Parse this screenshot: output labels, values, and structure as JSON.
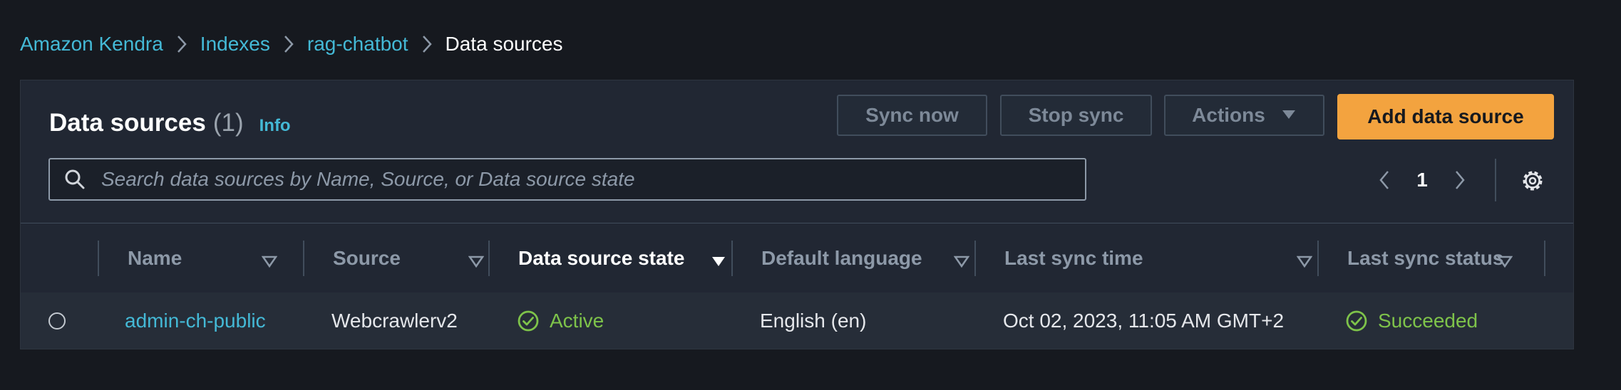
{
  "breadcrumb": {
    "items": [
      "Amazon Kendra",
      "Indexes",
      "rag-chatbot"
    ],
    "current": "Data sources"
  },
  "panel": {
    "title": "Data sources",
    "count": "(1)",
    "info": "Info"
  },
  "toolbar": {
    "sync_now": "Sync now",
    "stop_sync": "Stop sync",
    "actions": "Actions",
    "add": "Add data source"
  },
  "search": {
    "placeholder": "Search data sources by Name, Source, or Data source state"
  },
  "pagination": {
    "page": "1"
  },
  "table": {
    "columns": [
      "Name",
      "Source",
      "Data source state",
      "Default language",
      "Last sync time",
      "Last sync status"
    ],
    "rows": [
      {
        "name": "admin-ch-public",
        "source": "Webcrawlerv2",
        "state": "Active",
        "language": "English (en)",
        "last_sync_time": "Oct 02, 2023, 11:05 AM GMT+2",
        "last_sync_status": "Succeeded"
      }
    ]
  },
  "colors": {
    "background": "#16191f",
    "link": "#44b9d6",
    "primary_button": "#f3a33f",
    "success": "#7ec34a"
  }
}
